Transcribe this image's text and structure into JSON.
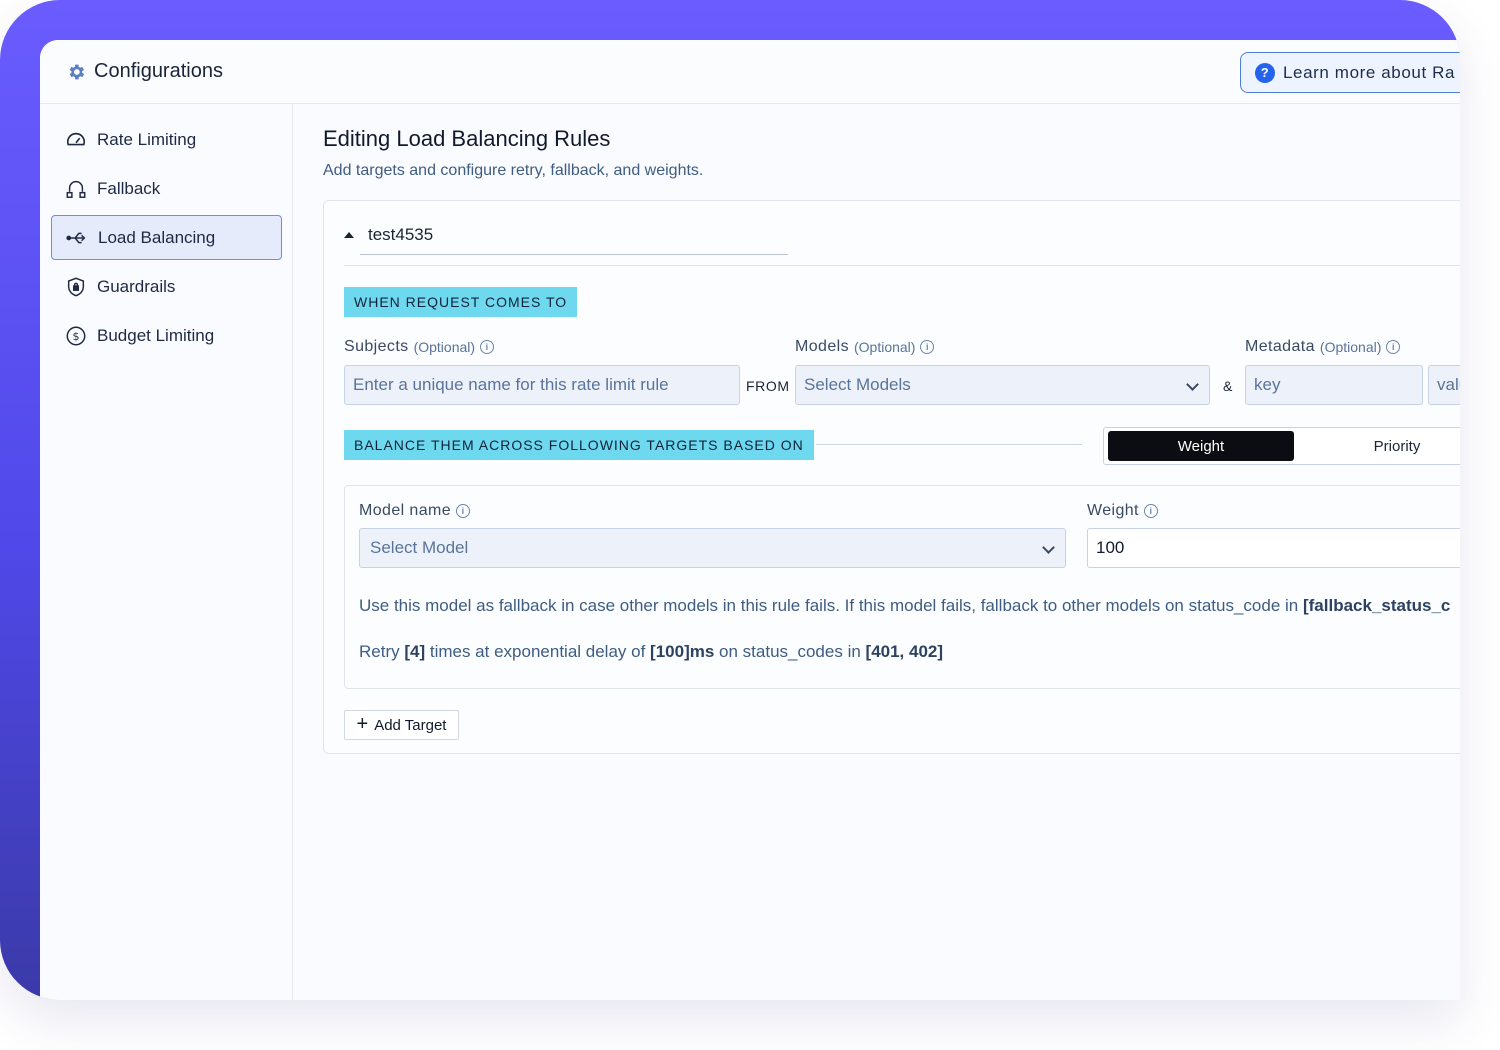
{
  "header": {
    "title": "Configurations",
    "learn_more_label": "Learn more about Ra"
  },
  "sidebar": {
    "items": [
      {
        "label": "Rate Limiting",
        "icon": "speedometer-icon"
      },
      {
        "label": "Fallback",
        "icon": "fallback-icon"
      },
      {
        "label": "Load Balancing",
        "icon": "load-balancing-icon",
        "active": true
      },
      {
        "label": "Guardrails",
        "icon": "shield-lock-icon"
      },
      {
        "label": "Budget Limiting",
        "icon": "dollar-icon"
      }
    ]
  },
  "main": {
    "title": "Editing Load Balancing Rules",
    "subtitle": "Add targets and configure retry, fallback, and weights.",
    "rule": {
      "name": "test4535",
      "when_tag": "WHEN REQUEST COMES TO",
      "subjects": {
        "label": "Subjects",
        "optional": "(Optional)",
        "placeholder": "Enter a unique name for this rate limit rule"
      },
      "from_label": "FROM",
      "models": {
        "label": "Models",
        "optional": "(Optional)",
        "placeholder": "Select Models"
      },
      "and_label": "&",
      "metadata": {
        "label": "Metadata",
        "optional": "(Optional)",
        "key_placeholder": "key",
        "value_placeholder": "valu"
      },
      "balance_tag": "BALANCE THEM ACROSS FOLLOWING TARGETS BASED ON",
      "toggle": {
        "weight": "Weight",
        "priority": "Priority",
        "selected": "Weight"
      },
      "target": {
        "model_label": "Model name",
        "model_placeholder": "Select Model",
        "weight_label": "Weight",
        "weight_value": "100",
        "fallback_text": "Use this model as fallback in case other models in this rule fails. If this model fails, fallback to other models on status_code in ",
        "fallback_codes": "[fallback_status_c",
        "retry_prefix": "Retry ",
        "retry_count": "[4]",
        "retry_mid": " times at exponential delay of ",
        "retry_delay": "[100]ms",
        "retry_mid2": " on status_codes in ",
        "retry_codes": "[401, 402]"
      },
      "add_target_label": "Add Target"
    }
  },
  "colors": {
    "accent": "#6a5cff",
    "tag": "#6ed8ee",
    "active_nav": "#e5ebfb",
    "link_blue": "#2563eb"
  }
}
